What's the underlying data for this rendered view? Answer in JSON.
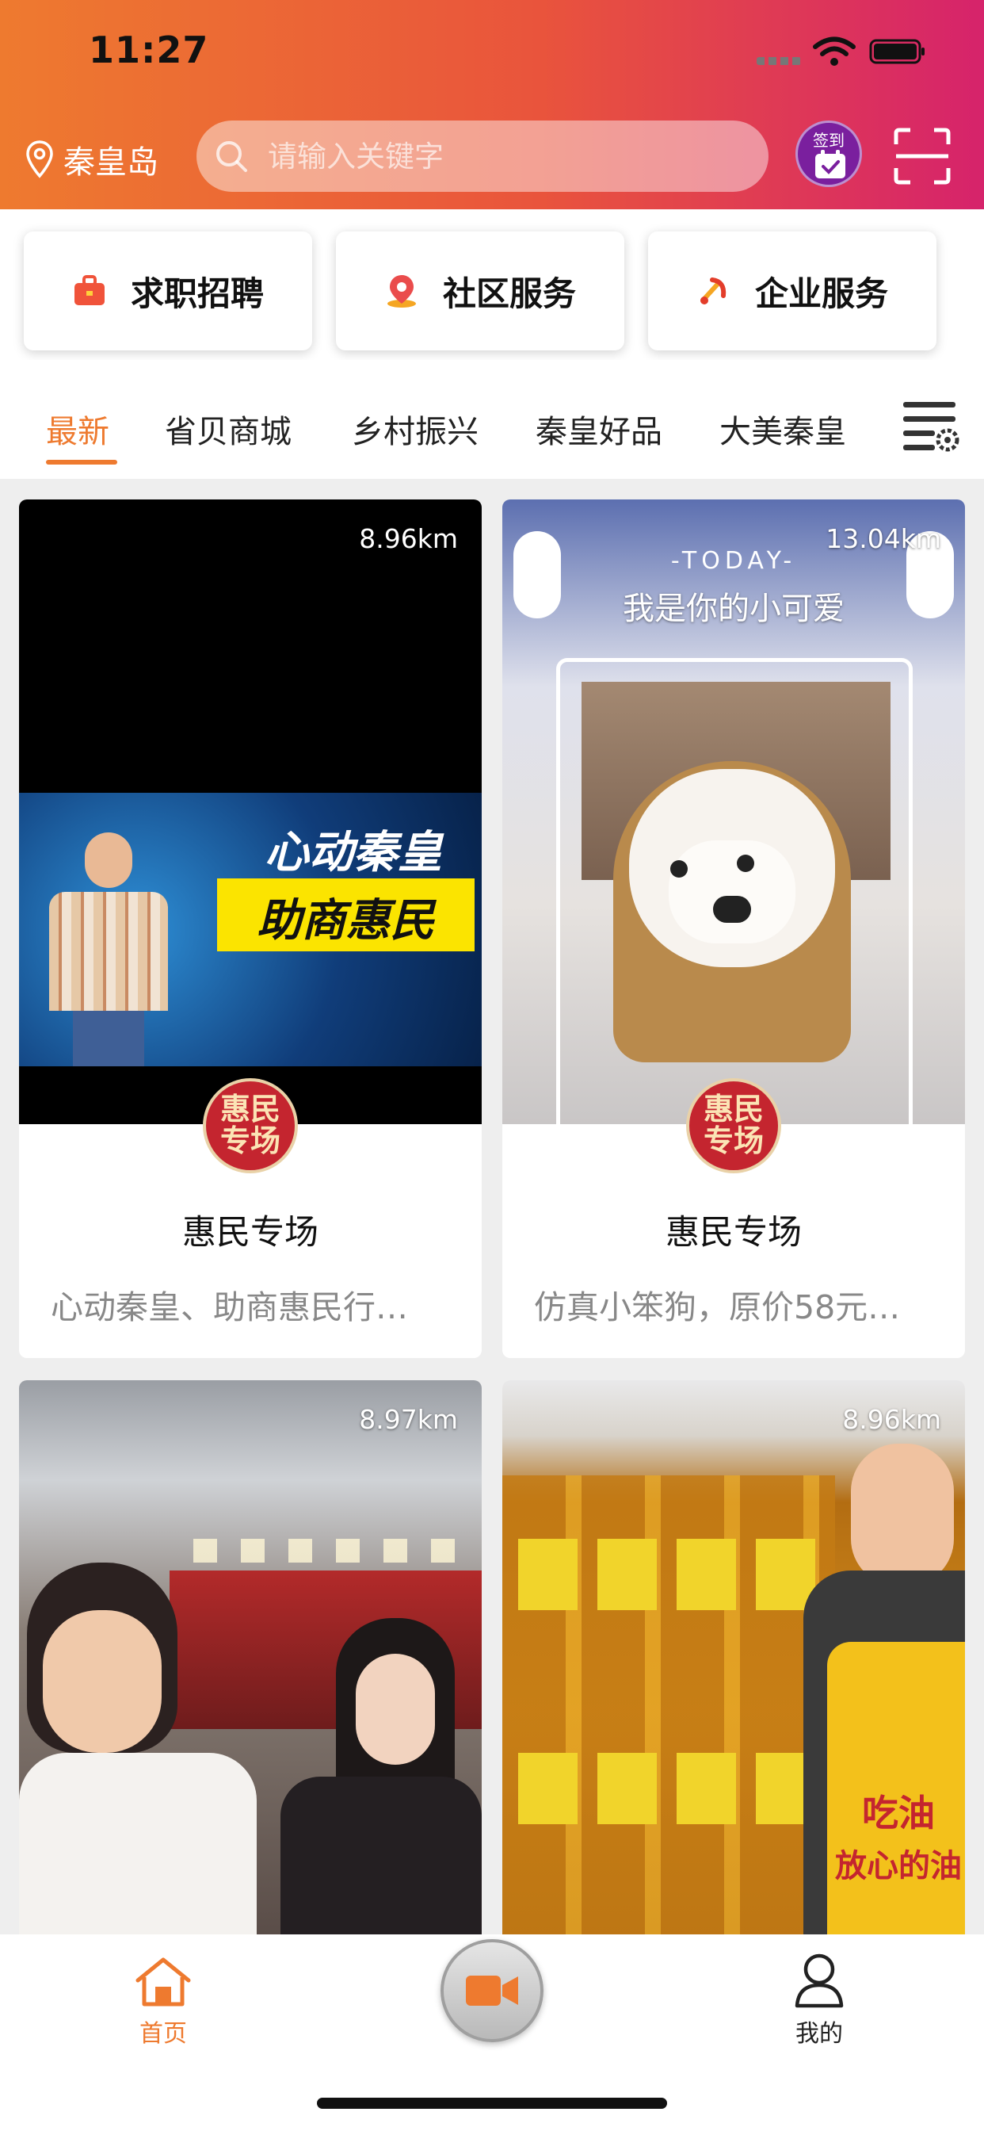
{
  "status_bar": {
    "time": "11:27"
  },
  "header": {
    "location": "秦皇岛",
    "search_placeholder": "请输入关键字",
    "signin_label": "签到"
  },
  "services": [
    {
      "label": "求职招聘",
      "icon": "briefcase-icon"
    },
    {
      "label": "社区服务",
      "icon": "map-pin-icon"
    },
    {
      "label": "企业服务",
      "icon": "party-emblem-icon"
    }
  ],
  "tabs": [
    {
      "label": "最新",
      "active": true
    },
    {
      "label": "省贝商城",
      "active": false
    },
    {
      "label": "乡村振兴",
      "active": false
    },
    {
      "label": "秦皇好品",
      "active": false
    },
    {
      "label": "大美秦皇",
      "active": false
    }
  ],
  "cards": [
    {
      "distance": "8.96km",
      "badge": "惠民专场",
      "title": "惠民专场",
      "desc": "心动秦皇、助商惠民行…",
      "overlay_line1": "心动秦皇",
      "overlay_line2": "助商惠民"
    },
    {
      "distance": "13.04km",
      "badge": "惠民专场",
      "title": "惠民专场",
      "desc": "仿真小笨狗，原价58元…",
      "overlay_top": "-TODAY-",
      "overlay_line1": "我是你的小可爱"
    },
    {
      "distance": "8.97km"
    },
    {
      "distance": "8.96km",
      "overlay_line1": "吃油",
      "overlay_line2": "放心的油"
    }
  ],
  "tabbar": {
    "home_label": "首页",
    "me_label": "我的"
  },
  "colors": {
    "accent": "#ee7a2f",
    "header_start": "#ee7a2f",
    "header_end": "#d6236b"
  }
}
